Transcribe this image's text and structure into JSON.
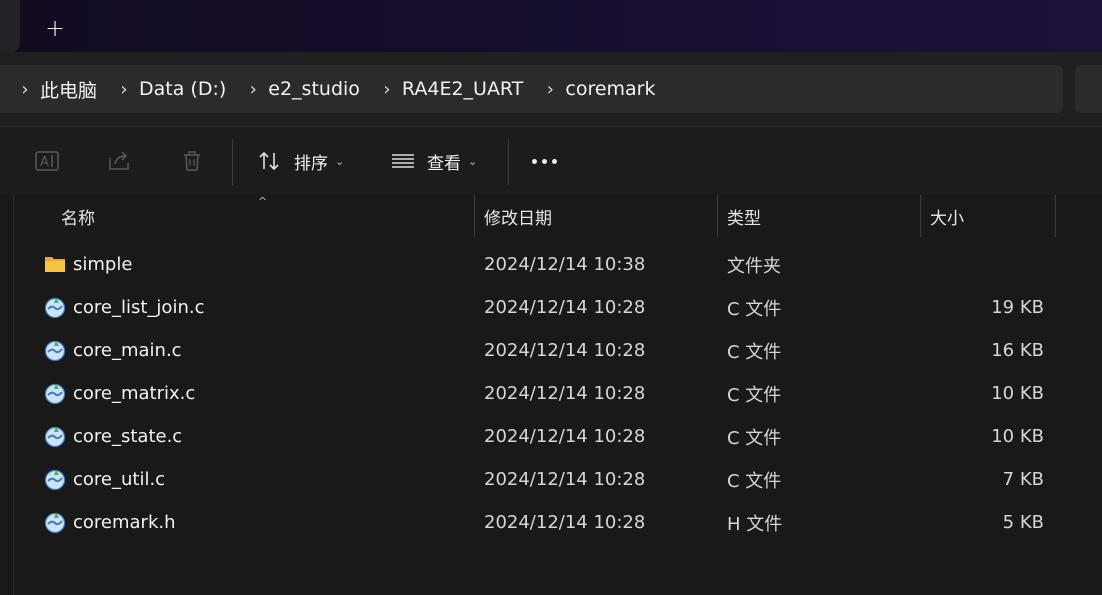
{
  "titlebar": {
    "new_tab_label": "+"
  },
  "breadcrumb": [
    "此电脑",
    "Data (D:)",
    "e2_studio",
    "RA4E2_UART",
    "coremark"
  ],
  "toolbar": {
    "rename_icon": "rename-icon",
    "share_icon": "share-icon",
    "delete_icon": "trash-icon",
    "sort_label": "排序",
    "view_label": "查看",
    "more_icon": "more-icon"
  },
  "columns": {
    "name": "名称",
    "date": "修改日期",
    "type": "类型",
    "size": "大小"
  },
  "files": [
    {
      "icon": "folder-icon",
      "name": "simple",
      "date": "2024/12/14 10:38",
      "type": "文件夹",
      "size": ""
    },
    {
      "icon": "c-source-file-icon",
      "name": "core_list_join.c",
      "date": "2024/12/14 10:28",
      "type": "C 文件",
      "size": "19 KB"
    },
    {
      "icon": "c-source-file-icon",
      "name": "core_main.c",
      "date": "2024/12/14 10:28",
      "type": "C 文件",
      "size": "16 KB"
    },
    {
      "icon": "c-source-file-icon",
      "name": "core_matrix.c",
      "date": "2024/12/14 10:28",
      "type": "C 文件",
      "size": "10 KB"
    },
    {
      "icon": "c-source-file-icon",
      "name": "core_state.c",
      "date": "2024/12/14 10:28",
      "type": "C 文件",
      "size": "10 KB"
    },
    {
      "icon": "c-source-file-icon",
      "name": "core_util.c",
      "date": "2024/12/14 10:28",
      "type": "C 文件",
      "size": "7 KB"
    },
    {
      "icon": "header-file-icon",
      "name": "coremark.h",
      "date": "2024/12/14 10:28",
      "type": "H 文件",
      "size": "5 KB"
    }
  ],
  "colors": {
    "folder": "#f5c542",
    "file_icon": "#4a90d9",
    "accent_green": "#4caf50",
    "background": "#191919"
  }
}
